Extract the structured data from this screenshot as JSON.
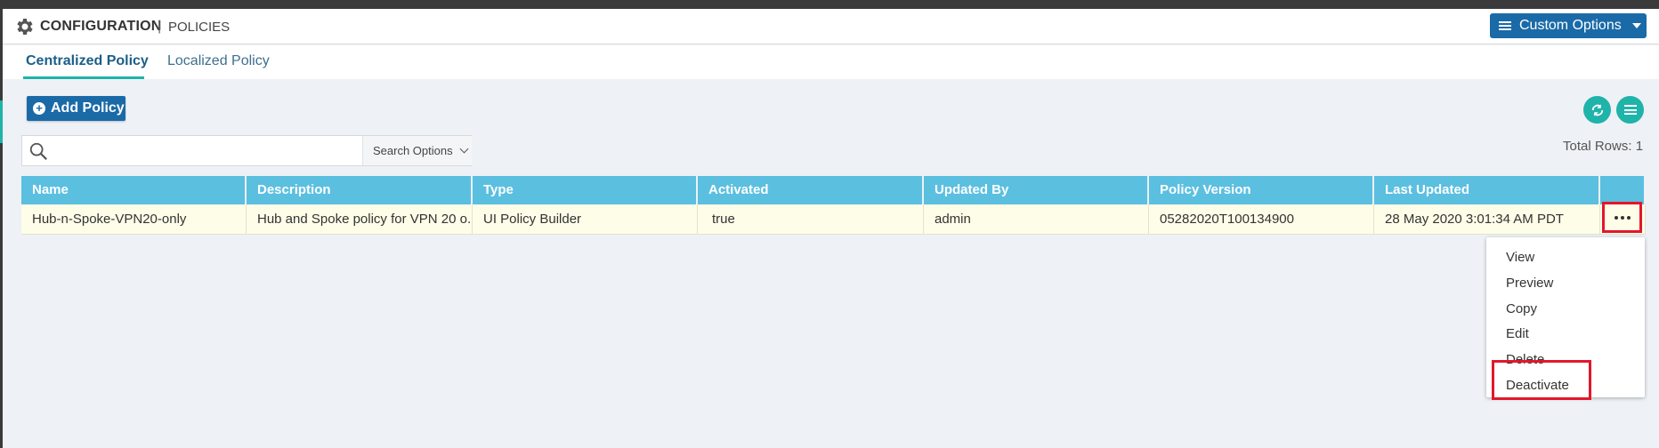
{
  "header": {
    "title": "CONFIGURATION",
    "separator": "|",
    "subtitle": "POLICIES",
    "custom_options_label": "Custom Options"
  },
  "tabs": [
    {
      "label": "Centralized Policy",
      "active": true
    },
    {
      "label": "Localized Policy",
      "active": false
    }
  ],
  "toolbar": {
    "add_policy_label": "Add Policy",
    "add_icon": "+",
    "search_options_label": "Search Options",
    "search_placeholder": "",
    "total_rows": "Total Rows: 1"
  },
  "table": {
    "columns": [
      "Name",
      "Description",
      "Type",
      "Activated",
      "Updated By",
      "Policy Version",
      "Last Updated"
    ],
    "rows": [
      {
        "name": "Hub-n-Spoke-VPN20-only",
        "description": "Hub and Spoke policy for VPN 20 o...",
        "type": "UI Policy Builder",
        "activated": "true",
        "updated_by": "admin",
        "policy_version": "05282020T100134900",
        "last_updated": "28 May 2020 3:01:34 AM PDT"
      }
    ]
  },
  "row_menu": {
    "items": [
      "View",
      "Preview",
      "Copy",
      "Edit",
      "Delete",
      "Deactivate"
    ]
  },
  "colors": {
    "brand_blue": "#1a6aa8",
    "teal": "#1fb3aa",
    "table_header": "#5bbfe0",
    "row_highlight": "#fdfde8",
    "annotation_red": "#e2172b"
  },
  "icons": {
    "header": "gear-icon",
    "search": "search-icon",
    "refresh": "refresh-icon",
    "menu": "hamburger-menu-icon",
    "row_actions": "more-horizontal-icon"
  }
}
